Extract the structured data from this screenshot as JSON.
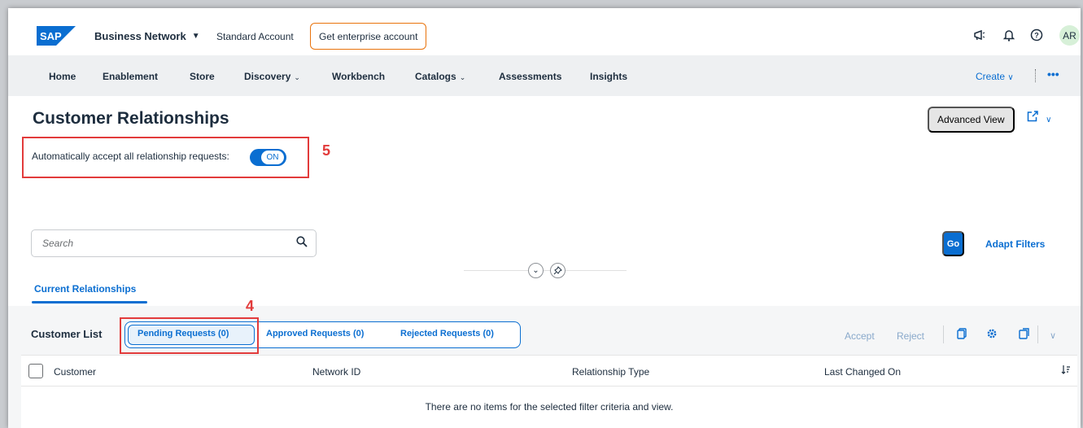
{
  "shell": {
    "logo": "SAP",
    "product_name": "Business Network",
    "account_label": "Standard Account",
    "enterprise_button": "Get enterprise account",
    "avatar_initials": "AR"
  },
  "nav": {
    "items": [
      "Home",
      "Enablement",
      "Store",
      "Discovery",
      "Workbench",
      "Catalogs",
      "Assessments",
      "Insights"
    ],
    "create_label": "Create"
  },
  "page": {
    "title": "Customer Relationships",
    "advanced_view_label": "Advanced View",
    "auto_accept_label": "Automatically accept all relationship requests:",
    "toggle_state": "ON"
  },
  "annotations": {
    "step_5": "5",
    "step_4": "4"
  },
  "filter": {
    "search_placeholder": "Search",
    "go_label": "Go",
    "adapt_filters_label": "Adapt Filters"
  },
  "tabs": {
    "current": "Current Relationships"
  },
  "list": {
    "title": "Customer List",
    "segments": [
      "Pending Requests (0)",
      "Approved Requests (0)",
      "Rejected Requests (0)"
    ],
    "accept_label": "Accept",
    "reject_label": "Reject",
    "columns": [
      "Customer",
      "Network ID",
      "Relationship Type",
      "Last Changed On"
    ],
    "empty_message": "There are no items for the selected filter criteria and view."
  },
  "colors": {
    "accent": "#0a6ed1",
    "highlight": "#e23b3b",
    "enterprise_border": "#e9730c"
  }
}
